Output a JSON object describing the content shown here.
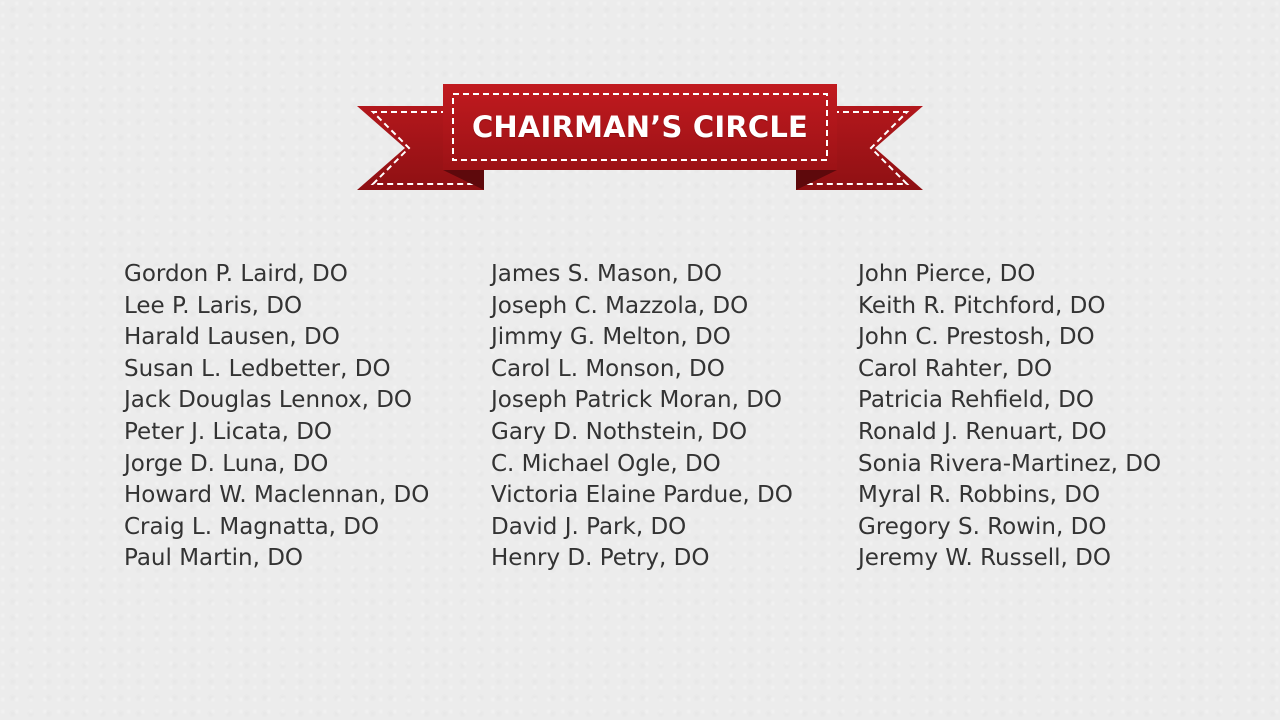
{
  "banner": {
    "title": "CHAIRMAN’S CIRCLE",
    "colors": {
      "ribbon_red": "#b5161b",
      "ribbon_dark": "#6e0b0e",
      "stitch": "#ffffff"
    }
  },
  "columns": [
    {
      "names": [
        "Gordon P. Laird, DO",
        "Lee P. Laris, DO",
        "Harald Lausen, DO",
        "Susan L. Ledbetter, DO",
        "Jack Douglas Lennox, DO",
        "Peter J. Licata, DO",
        "Jorge D. Luna, DO",
        "Howard W. Maclennan, DO",
        "Craig L. Magnatta, DO",
        "Paul Martin, DO"
      ]
    },
    {
      "names": [
        "James S. Mason, DO",
        "Joseph C. Mazzola, DO",
        "Jimmy G. Melton, DO",
        "Carol L. Monson, DO",
        "Joseph Patrick Moran, DO",
        "Gary D. Nothstein, DO",
        "C. Michael Ogle, DO",
        "Victoria Elaine Pardue, DO",
        "David J. Park, DO",
        "Henry D. Petry, DO"
      ]
    },
    {
      "names": [
        "John Pierce, DO",
        "Keith R. Pitchford, DO",
        "John C. Prestosh, DO",
        "Carol Rahter, DO",
        "Patricia Rehfield, DO",
        "Ronald J. Renuart, DO",
        "Sonia Rivera-Martinez, DO",
        "Myral R. Robbins, DO",
        "Gregory S. Rowin, DO",
        "Jeremy W. Russell, DO"
      ]
    }
  ]
}
